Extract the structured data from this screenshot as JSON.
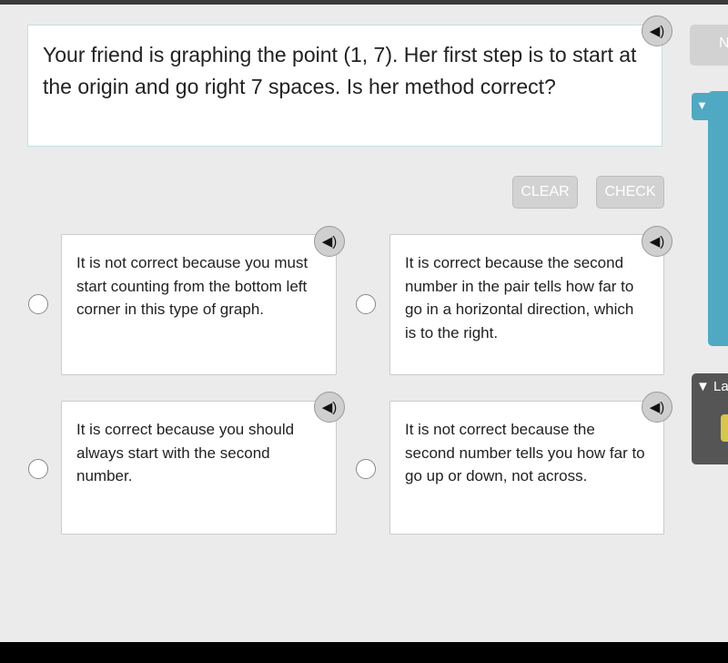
{
  "question": "Your friend is graphing the point (1, 7). Her first step is to start at the origin and go right 7 spaces. Is her method correct?",
  "buttons": {
    "clear": "CLEAR",
    "check": "CHECK",
    "next_partial": "N"
  },
  "options": [
    {
      "text": "It is not correct because you must start counting from the bottom left corner in this type of graph."
    },
    {
      "text": "It is correct because the second number in the pair tells how far to go in a horizontal direction, which is to the right."
    },
    {
      "text": "It is correct because you should always start with the second number."
    },
    {
      "text": "It is not correct because the second number tells you how far to go up or down, not across."
    }
  ],
  "side": {
    "panel_tab_icon": "▼",
    "lower_panel_label": "▼ La"
  },
  "icons": {
    "audio": "speaker-icon"
  },
  "colors": {
    "accent": "#4fa9c2",
    "button": "#d2d2d2"
  }
}
